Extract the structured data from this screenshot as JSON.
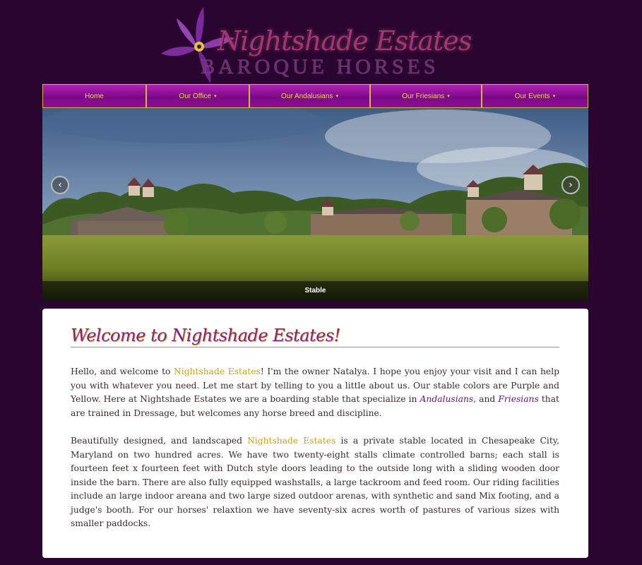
{
  "brand": {
    "title": "Nightshade Estates",
    "subtitle": "BAROQUE HORSES",
    "logo_icon": "purple-flower-icon"
  },
  "nav": {
    "items": [
      {
        "label": "Home",
        "caret": ""
      },
      {
        "label": "Our Office",
        "caret": "▾"
      },
      {
        "label": "Our Andalusians",
        "caret": "▾"
      },
      {
        "label": "Our Friesians",
        "caret": "▾"
      },
      {
        "label": "Our Events",
        "caret": "▾"
      }
    ]
  },
  "carousel": {
    "caption": "Stable",
    "prev_icon": "‹",
    "next_icon": "›"
  },
  "main": {
    "heading": "Welcome to Nightshade Estates!",
    "p1": {
      "t1": "Hello, and welcome to ",
      "hl1": "Nightshade Estates",
      "t2": "! I'm the owner Natalya. I hope you enjoy your visit and I can help you with whatever you need. Let me start by telling to you a little about us. Our stable colors are Purple and Yellow. Here at Nightshade Estates we are a boarding stable that specialize in ",
      "em1": "Andalusians",
      "t3": ", and ",
      "em2": "Friesians",
      "t4": " that are trained in Dressage, but welcomes any horse breed and discipline."
    },
    "p2": {
      "t1": "Beautifully designed, and landscaped ",
      "hl1": "Nightshade Estates",
      "t2": " is a private stable located in Chesapeake City, Maryland on two hundred acres. We have two twenty-eight stalls climate controlled barns; each stall is fourteen feet x fourteen feet with Dutch style doors leading to the outside long with a sliding wooden door inside the barn. There are also fully equipped washstalls, a large tackroom and feed room. Our riding facilities include an large indoor areana and two large sized outdoor arenas, with synthetic and sand Mix footing, and a judge's booth. For our horses' relaxtion we have seventy-six acres worth of pastures of various sizes with smaller paddocks."
    }
  },
  "colors": {
    "background": "#2a0530",
    "nav_purple": "#8c0f97",
    "nav_text": "#f2d34e",
    "accent_gold": "#c9a21d",
    "heading_purple": "#8a1f8a"
  }
}
